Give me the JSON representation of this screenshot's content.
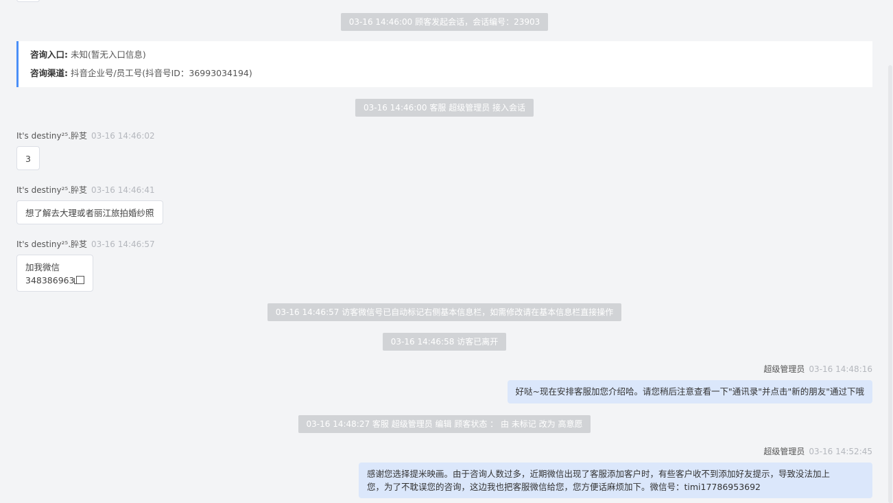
{
  "system_messages": [
    "03-16 14:46:00 顾客发起会话，会话编号：23903",
    "03-16 14:46:00 客服 超级管理员 接入会话",
    "03-16 14:46:57 访客微信号已自动标记右侧基本信息栏，如需修改请在基本信息栏直接操作",
    "03-16 14:46:58 访客已离开",
    "03-16 14:48:27 客服 超级管理员 编辑 顾客状态 ： 由 未标记 改为 高意愿"
  ],
  "info_card": {
    "entry_label": "咨询入口:",
    "entry_value": "未知(暂无入口信息)",
    "channel_label": "咨询渠道:",
    "channel_value": "抖音企业号/员工号(抖音号ID：36993034194)"
  },
  "messages": [
    {
      "sender": "It's destiny²⁵.肸䒝",
      "time": "03-16 14:46:02",
      "lines": [
        "3"
      ]
    },
    {
      "sender": "It's destiny²⁵.肸䒝",
      "time": "03-16 14:46:41",
      "lines": [
        "想了解去大理或者丽江旅拍婚纱照"
      ]
    },
    {
      "sender": "It's destiny²⁵.肸䒝",
      "time": "03-16 14:46:57",
      "lines": [
        "加我微信",
        "348386963"
      ]
    },
    {
      "sender": "超级管理员",
      "time": "03-16 14:48:16",
      "lines": [
        "好哒~现在安排客服加您介绍哈。请您稍后注意查看一下\"通讯录\"并点击\"新的朋友\"通过下哦"
      ]
    },
    {
      "sender": "超级管理员",
      "time": "03-16 14:52:45",
      "lines": [
        "感谢您选择提米映画。由于咨询人数过多，近期微信出现了客服添加客户时，有些客户收不到添加好友提示，导致没法加上",
        "您，为了不耽误您的咨询，这边我也把客服微信给您，您方便话麻烦加下。微信号：timi17786953692"
      ]
    }
  ]
}
